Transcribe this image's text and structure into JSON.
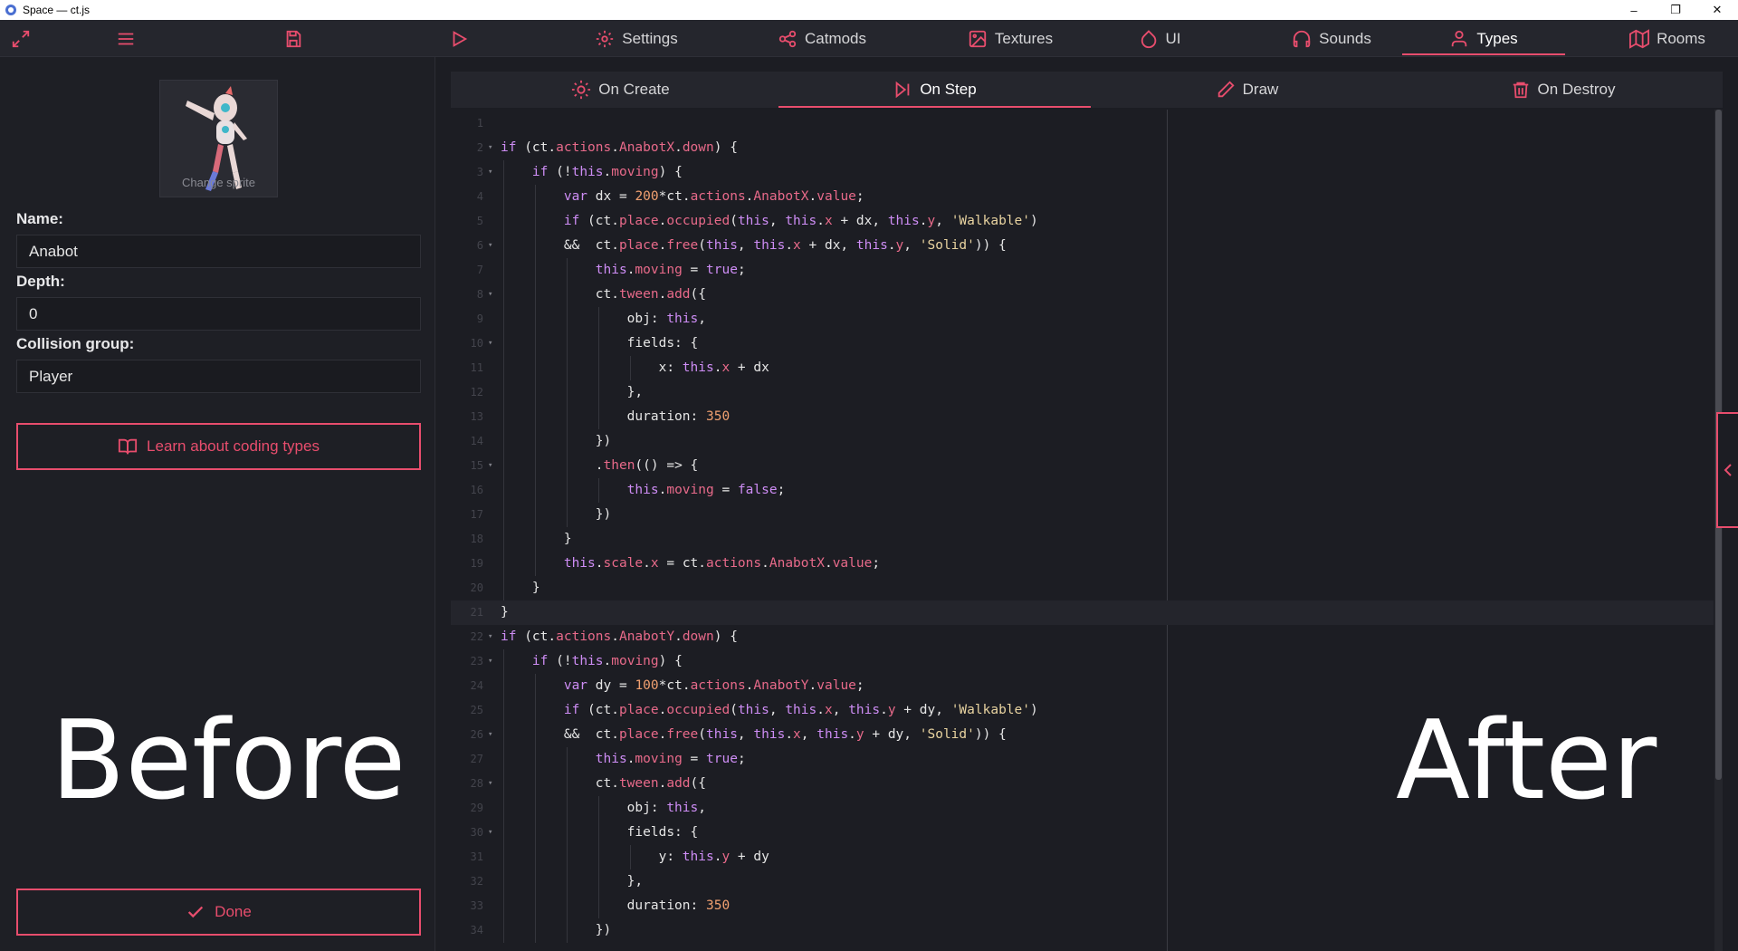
{
  "window": {
    "title": "Space — ct.js",
    "controls": [
      "–",
      "❐",
      "✕"
    ]
  },
  "toolbar": {
    "icons": [
      "expand-icon",
      "menu-icon",
      "save-icon",
      "play-icon"
    ],
    "tabs": [
      {
        "label": "Settings",
        "icon": "gear-icon"
      },
      {
        "label": "Catmods",
        "icon": "catmods-icon"
      },
      {
        "label": "Textures",
        "icon": "image-icon"
      },
      {
        "label": "UI",
        "icon": "droplet-icon"
      },
      {
        "label": "Sounds",
        "icon": "headphones-icon"
      },
      {
        "label": "Types",
        "icon": "user-icon",
        "active": true
      },
      {
        "label": "Rooms",
        "icon": "map-icon"
      }
    ]
  },
  "left_panel": {
    "sprite_label": "Change sprite",
    "name_label": "Name:",
    "name_value": "Anabot",
    "depth_label": "Depth:",
    "depth_value": "0",
    "group_label": "Collision group:",
    "group_value": "Player",
    "learn_label": "Learn about coding types",
    "done_label": "Done"
  },
  "captions": {
    "before": "Before",
    "after": "After"
  },
  "event_tabs": [
    {
      "label": "On Create",
      "icon": "sun-icon"
    },
    {
      "label": "On Step",
      "icon": "step-icon",
      "active": true
    },
    {
      "label": "Draw",
      "icon": "pencil-icon"
    },
    {
      "label": "On Destroy",
      "icon": "trash-icon"
    }
  ],
  "code_lines": [
    "",
    "if (ct.actions.AnabotX.down) {",
    "    if (!this.moving) {",
    "        var dx = 200*ct.actions.AnabotX.value;",
    "        if (ct.place.occupied(this, this.x + dx, this.y, 'Walkable')",
    "        &&  ct.place.free(this, this.x + dx, this.y, 'Solid')) {",
    "            this.moving = true;",
    "            ct.tween.add({",
    "                obj: this,",
    "                fields: {",
    "                    x: this.x + dx",
    "                },",
    "                duration: 350",
    "            })",
    "            .then(() => {",
    "                this.moving = false;",
    "            })",
    "        }",
    "        this.scale.x = ct.actions.AnabotX.value;",
    "    }",
    "}",
    "if (ct.actions.AnabotY.down) {",
    "    if (!this.moving) {",
    "        var dy = 100*ct.actions.AnabotY.value;",
    "        if (ct.place.occupied(this, this.x, this.y + dy, 'Walkable')",
    "        &&  ct.place.free(this, this.x, this.y + dy, 'Solid')) {",
    "            this.moving = true;",
    "            ct.tween.add({",
    "                obj: this,",
    "                fields: {",
    "                    y: this.y + dy",
    "                },",
    "                duration: 350",
    "            })"
  ],
  "colors": {
    "accent": "#e84d6d",
    "background": "#1c1d23",
    "panel": "#25262d",
    "keyword": "#ce8df5",
    "property": "#e86a8a",
    "string": "#e8d3a0",
    "number": "#f0a070"
  }
}
